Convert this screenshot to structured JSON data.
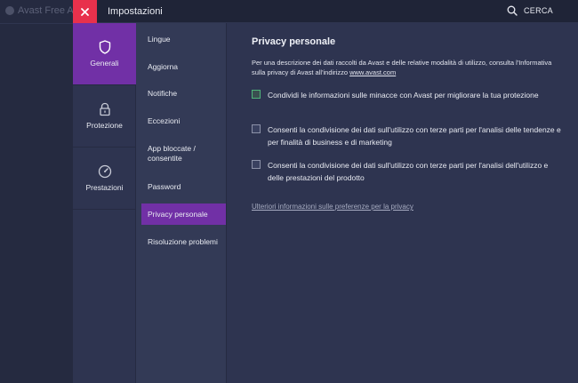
{
  "background_app": {
    "title": "Avast Free A"
  },
  "titlebar": {
    "title": "Impostazioni",
    "search_label": "CERCA"
  },
  "categories": [
    {
      "label": "Generali",
      "icon": "shield-icon",
      "active": true
    },
    {
      "label": "Protezione",
      "icon": "lock-icon",
      "active": false
    },
    {
      "label": "Prestazioni",
      "icon": "gauge-icon",
      "active": false
    }
  ],
  "submenu": [
    {
      "label": "Lingue"
    },
    {
      "label": "Aggiorna"
    },
    {
      "label": "Notifiche"
    },
    {
      "label": "Eccezioni"
    },
    {
      "label": "App bloccate / consentite"
    },
    {
      "label": "Password"
    },
    {
      "label": "Privacy personale",
      "active": true
    },
    {
      "label": "Risoluzione problemi"
    }
  ],
  "content": {
    "title": "Privacy personale",
    "desc_text": "Per una descrizione dei dati raccolti da Avast e delle relative modalità di utilizzo, consulta l'Informativa sulla privacy di Avast all'indirizzo ",
    "desc_link": "www.avast.com",
    "options": [
      {
        "label": "Condividi le informazioni sulle minacce con Avast per migliorare la tua protezione",
        "checked": true
      },
      {
        "label": "Consenti la condivisione dei dati sull'utilizzo con terze parti per l'analisi delle tendenze e per finalità di business e di marketing",
        "checked": false
      },
      {
        "label": "Consenti la condivisione dei dati sull'utilizzo con terze parti per l'analisi dell'utilizzo e delle prestazioni del prodotto",
        "checked": false
      }
    ],
    "more_link": "Ulteriori informazioni sulle preferenze per la privacy"
  },
  "colors": {
    "accent": "#7130a6",
    "close": "#e8314c",
    "panel": "#2e3450",
    "checkbox_checked": "#4fb47a"
  }
}
